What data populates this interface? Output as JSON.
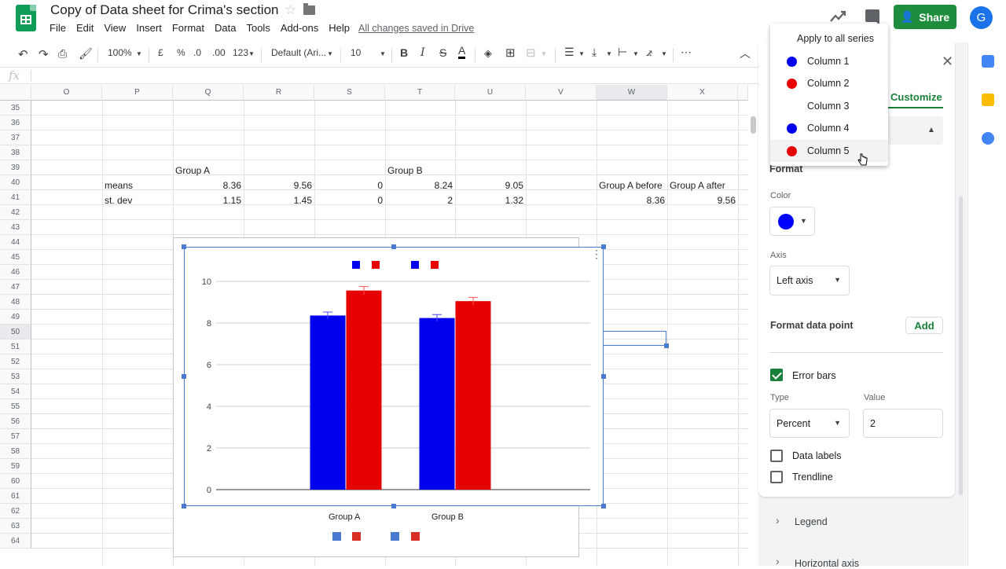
{
  "app": {
    "doc_title": "Copy of Data sheet for Crima's section",
    "menu": [
      "File",
      "Edit",
      "View",
      "Insert",
      "Format",
      "Data",
      "Tools",
      "Add-ons",
      "Help"
    ],
    "saved_status": "All changes saved in Drive",
    "share_label": "Share",
    "avatar_letter": "G"
  },
  "toolbar": {
    "zoom": "100%",
    "currency": "£",
    "percent": "%",
    "dec_decrease": ".0",
    "dec_increase": ".00",
    "more_formats": "123",
    "font": "Default (Ari...",
    "font_size": "10",
    "bold": "B",
    "italic": "I",
    "strike": "S",
    "text_color": "A",
    "more": "⋯"
  },
  "formula_bar": {
    "fx": "fx"
  },
  "grid": {
    "columns": [
      "O",
      "P",
      "Q",
      "R",
      "S",
      "T",
      "U",
      "V",
      "W",
      "X"
    ],
    "rows": [
      "35",
      "36",
      "37",
      "38",
      "39",
      "40",
      "41",
      "42",
      "43",
      "44",
      "45",
      "46",
      "47",
      "48",
      "49",
      "50",
      "51",
      "52",
      "53",
      "54",
      "55",
      "56",
      "57",
      "58",
      "59",
      "60",
      "61",
      "62",
      "63",
      "64"
    ],
    "cells": {
      "p40": "means",
      "p41": "st. dev",
      "q39": "Group A",
      "t39": "Group B",
      "q40": "8.36",
      "r40": "9.56",
      "s40": "0",
      "t40": "8.24",
      "u40": "9.05",
      "q41": "1.15",
      "r41": "1.45",
      "s41": "0",
      "t41": "2",
      "u41": "1.32",
      "w40": "Group A before",
      "x40": "Group A after",
      "w41": "8.36",
      "x41": "9.56"
    }
  },
  "chart_data": {
    "type": "bar",
    "categories": [
      "Group A",
      "Group B"
    ],
    "series": [
      {
        "values": [
          8.36,
          8.24
        ],
        "color": "#0000ee"
      },
      {
        "values": [
          9.56,
          9.05
        ],
        "color": "#e60000"
      }
    ],
    "error_bars": {
      "type": "Percent",
      "value": 2,
      "series": [
        0,
        1
      ]
    },
    "y_ticks": [
      "0",
      "2",
      "4",
      "6",
      "8",
      "10"
    ],
    "ylim": [
      0,
      10
    ],
    "grid": true,
    "legend": "top"
  },
  "panel": {
    "tab_customize": "Customize",
    "format_heading": "Format",
    "color_label": "Color",
    "color_value": "#0000ff",
    "axis_label": "Axis",
    "axis_value": "Left axis",
    "format_data_point": "Format data point",
    "add_label": "Add",
    "error_bars_label": "Error bars",
    "type_label": "Type",
    "type_value": "Percent",
    "value_label": "Value",
    "value_value": "2",
    "data_labels_label": "Data labels",
    "trendline_label": "Trendline",
    "legend_section": "Legend",
    "haxis_section": "Horizontal axis"
  },
  "series_dropdown": {
    "apply_all": "Apply to all series",
    "items": [
      {
        "label": "Column 1",
        "color": "#0000ee"
      },
      {
        "label": "Column 2",
        "color": "#e60000"
      },
      {
        "label": "Column 3",
        "color": ""
      },
      {
        "label": "Column 4",
        "color": "#0000ee"
      },
      {
        "label": "Column 5",
        "color": "#e60000"
      }
    ]
  }
}
